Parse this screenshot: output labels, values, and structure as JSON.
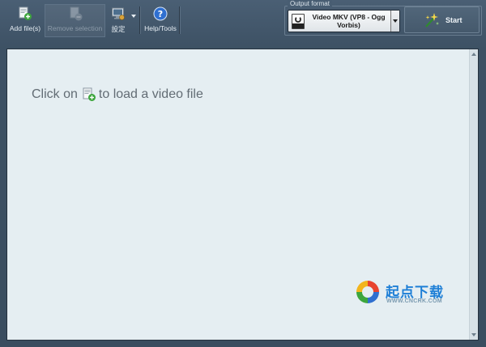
{
  "toolbar": {
    "add_files_label": "Add file(s)",
    "remove_selection_label": "Remove selection",
    "settings_label": "設定",
    "help_tools_label": "Help/Tools"
  },
  "output_format": {
    "legend": "Output format",
    "selected_line1": "Video MKV (VP8 - Ogg",
    "selected_line2": "Vorbis)",
    "format_icon": "mkv-icon"
  },
  "start_button": {
    "label": "Start",
    "icon": "sparkle-wand-icon"
  },
  "main": {
    "hint_before": "Click on",
    "hint_after": "to load a video file",
    "hint_icon": "add-file-icon"
  },
  "watermark": {
    "title": "起点下载",
    "url": "WWW.CNCRK.COM"
  },
  "colors": {
    "background": "#3f5366",
    "panel": "#e5eef2",
    "accent_green": "#3da63d",
    "watermark_blue": "#1e7fd6"
  }
}
